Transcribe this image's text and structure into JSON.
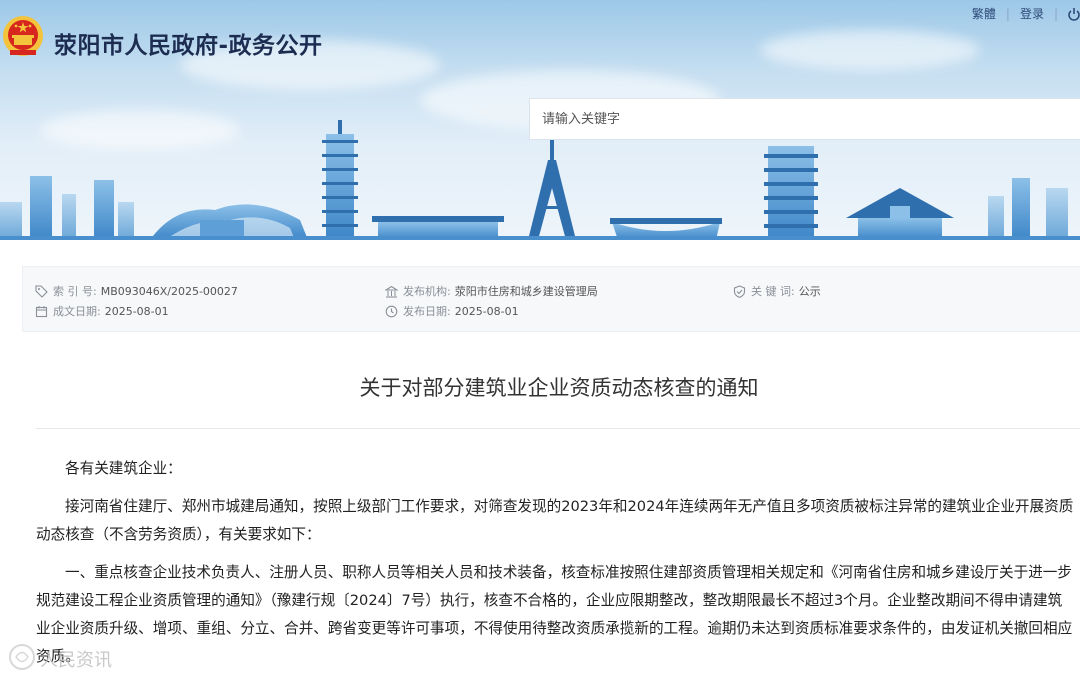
{
  "header": {
    "site_title": "荥阳市人民政府-政务公开",
    "links": {
      "traditional": "繁體",
      "login": "登录"
    },
    "search": {
      "placeholder": "请输入关键字"
    }
  },
  "meta": {
    "index_label": "索 引 号:",
    "index_value": "MB093046X/2025-00027",
    "publisher_label": "发布机构:",
    "publisher_value": "荥阳市住房和城乡建设管理局",
    "keywords_label": "关 键 词:",
    "keywords_value": "公示",
    "created_label": "成文日期:",
    "created_value": "2025-08-01",
    "published_label": "发布日期:",
    "published_value": "2025-08-01"
  },
  "article": {
    "title": "关于对部分建筑业企业资质动态核查的通知",
    "paragraphs": [
      "各有关建筑企业：",
      "接河南省住建厅、郑州市城建局通知，按照上级部门工作要求，对筛查发现的2023年和2024年连续两年无产值且多项资质被标注异常的建筑业企业开展资质动态核查（不含劳务资质），有关要求如下：",
      "一、重点核查企业技术负责人、注册人员、职称人员等相关人员和技术装备，核查标准按照住建部资质管理相关规定和《河南省住房和城乡建设厅关于进一步规范建设工程企业资质管理的通知》（豫建行规〔2024〕7号）执行，核查不合格的，企业应限期整改，整改期限最长不超过3个月。企业整改期间不得申请建筑业企业资质升级、增项、重组、分立、合并、跨省变更等许可事项，不得使用待整改资质承揽新的工程。逾期仍未达到资质标准要求条件的，由发证机关撤回相应资质。"
    ]
  },
  "watermark": {
    "text": "人民资讯"
  },
  "colors": {
    "title": "#1d2d52",
    "emblem_red": "#d7261d",
    "emblem_gold": "#f3c33c",
    "skyline": "#5a9fd6"
  }
}
